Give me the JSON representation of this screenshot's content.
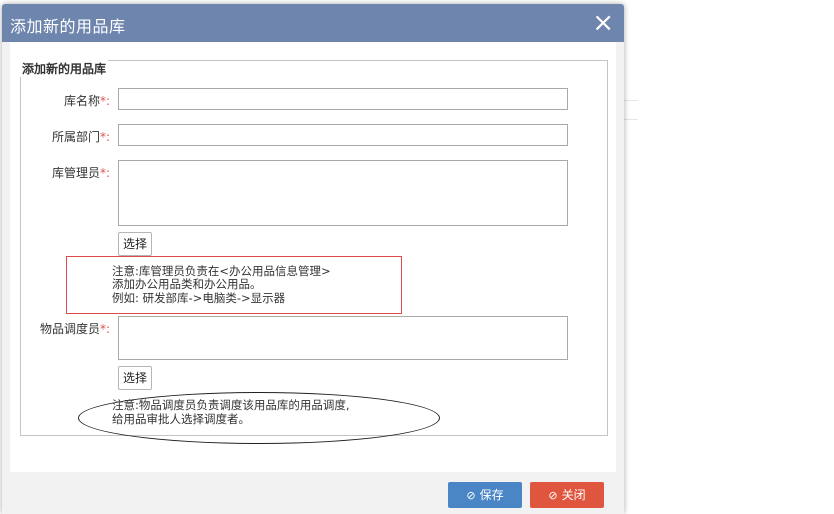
{
  "dialog": {
    "title": "添加新的用品库",
    "close_icon": "×"
  },
  "form": {
    "legend": "添加新的用品库",
    "fields": [
      {
        "label": "库名称",
        "required_mark": "*:"
      },
      {
        "label": "所属部门",
        "required_mark": "*:"
      },
      {
        "label": "库管理员",
        "required_mark": "*:"
      },
      {
        "label": "物品调度员",
        "required_mark": "*:"
      }
    ],
    "select_label_1": "选择",
    "select_label_2": "选择",
    "note_manager": [
      "注意:库管理员负责在<办公用品信息管理>",
      "添加办公用品类和办公用品。",
      "例如: 研发部库->电脑类->显示器"
    ],
    "note_dispatcher": [
      "注意:物品调度员负责调度该用品库的用品调度,",
      "给用品审批人选择调度者。"
    ]
  },
  "footer": {
    "save_label": "保存",
    "close_label": "关闭",
    "save_icon": "⊘",
    "close_icon": "⊘"
  },
  "colors": {
    "titlebar": "#6e85ae",
    "save": "#4a86c5",
    "close": "#e0553e",
    "required": "#d9534f"
  }
}
